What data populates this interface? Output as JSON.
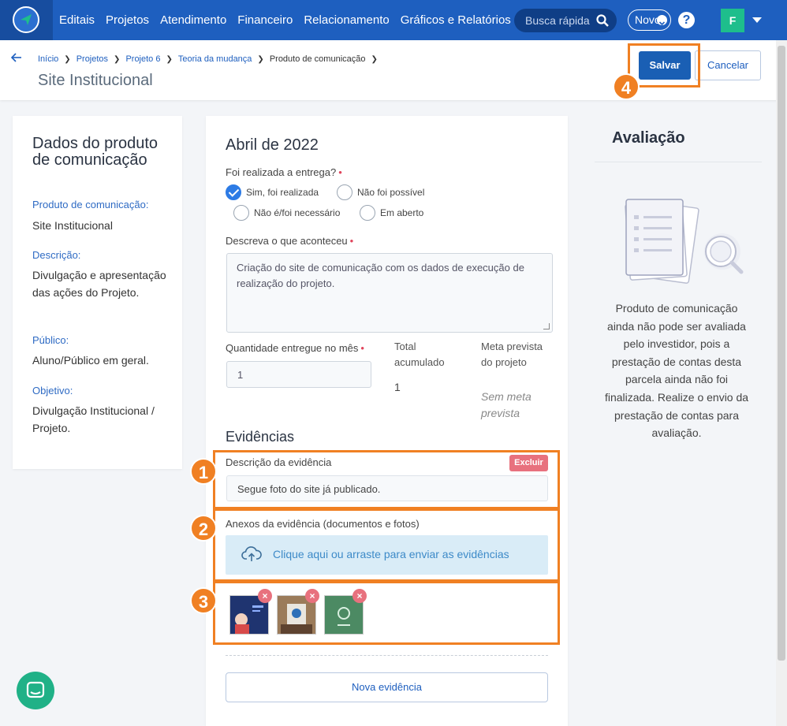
{
  "nav": {
    "links": [
      "Editais",
      "Projetos",
      "Atendimento",
      "Financeiro",
      "Relacionamento",
      "Gráficos e Relatórios"
    ],
    "search_placeholder": "Busca rápida",
    "novo_label": "Novo",
    "help_label": "?",
    "avatar_letter": "F"
  },
  "header": {
    "breadcrumb": [
      "Início",
      "Projetos",
      "Projeto 6",
      "Teoria da mudança",
      "Produto de comunicação"
    ],
    "title": "Site Institucional",
    "save_label": "Salvar",
    "cancel_label": "Cancelar"
  },
  "left": {
    "heading": "Dados do produto de comunicação",
    "fields": [
      {
        "label": "Produto de comunicação:",
        "value": "Site Institucional"
      },
      {
        "label": "Descrição:",
        "value": "Divulgação e apresentação das ações do Projeto."
      },
      {
        "label": "Público:",
        "value": "Aluno/Público em geral."
      },
      {
        "label": "Objetivo:",
        "value": "Divulgação Institucional / Projeto."
      }
    ]
  },
  "main": {
    "month": "Abril de 2022",
    "delivery_question": "Foi realizada a entrega?",
    "options": [
      "Sim, foi realizada",
      "Não foi possível",
      "Não é/foi necessário",
      "Em aberto"
    ],
    "selected_option": "Sim, foi realizada",
    "describe_label": "Descreva o que aconteceu",
    "describe_value": "Criação do site de comunicação com os dados de execução de realização do projeto.",
    "qty_label": "Quantidade entregue no mês",
    "qty_value": "1",
    "total_label": "Total acumulado",
    "total_value": "1",
    "meta_label": "Meta prevista do projeto",
    "meta_value": "Sem meta prevista",
    "evidencias_title": "Evidências",
    "evid_desc_label": "Descrição da evidência",
    "excluir_label": "Excluir",
    "evid_desc_value": "Segue foto do site já publicado.",
    "anexos_label": "Anexos da evidência (documentos e fotos)",
    "upload_label": "Clique aqui ou arraste para enviar as evidências",
    "remove_label": "×",
    "nova_label": "Nova evidência"
  },
  "right": {
    "title": "Avaliação",
    "message": "Produto de comunicação ainda não pode ser avaliada pelo investidor, pois a prestação de contas desta parcela ainda não foi finalizada. Realize o envio da prestação de contas para avaliação."
  },
  "annotations": [
    "1",
    "2",
    "3",
    "4"
  ],
  "colors": {
    "nav": "#1e5fbf",
    "accent": "#f08023",
    "save": "#1a5fb4",
    "danger": "#e8717e"
  }
}
